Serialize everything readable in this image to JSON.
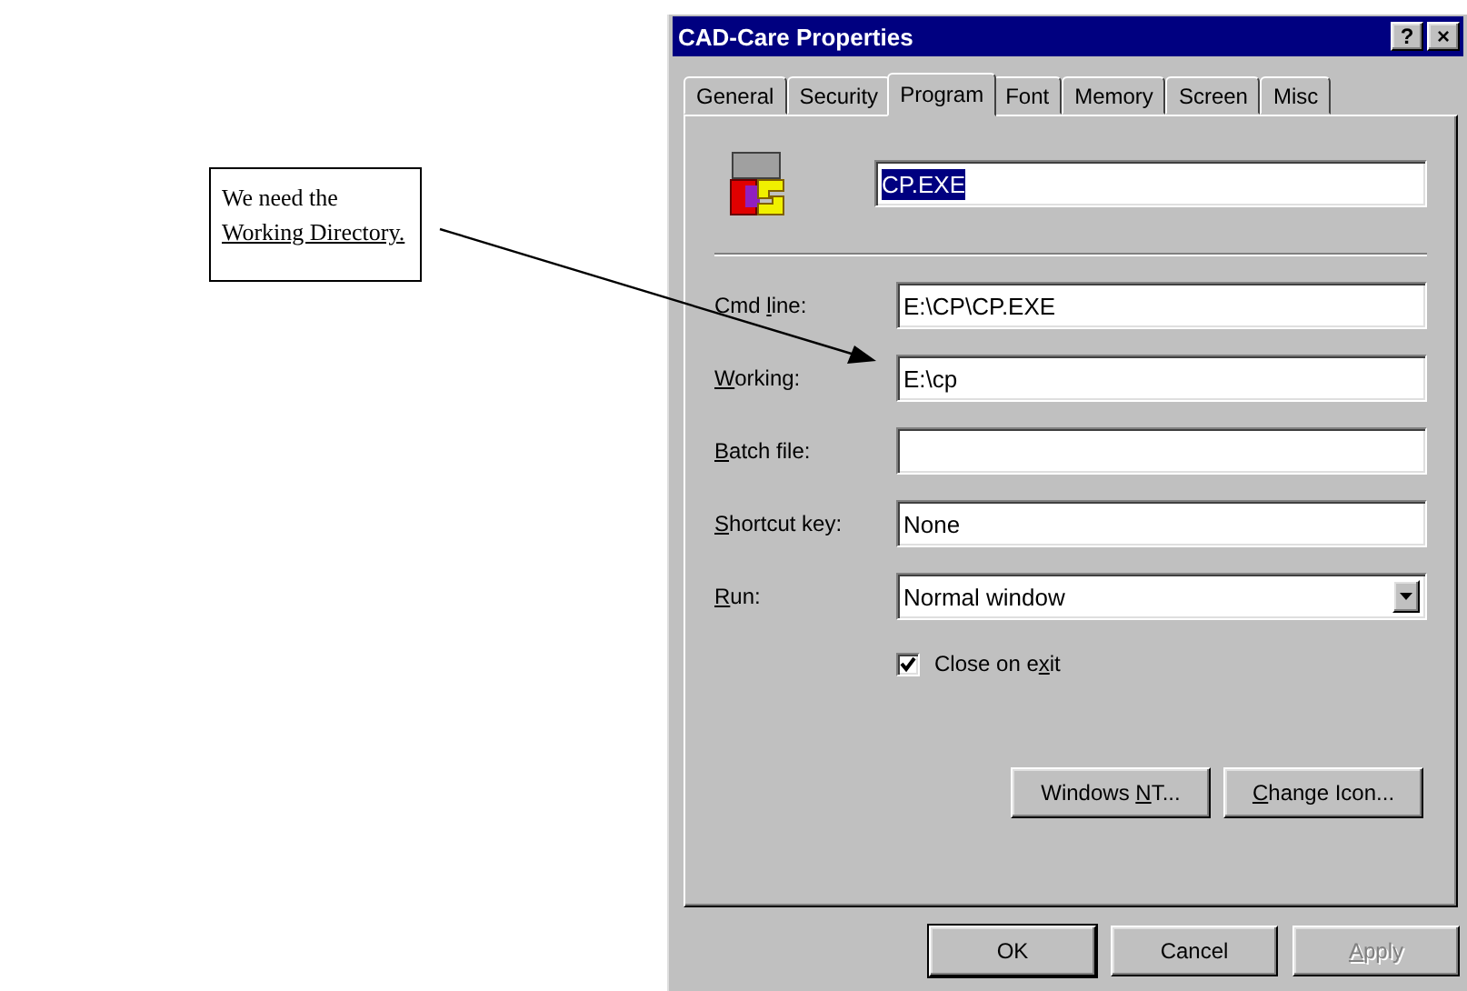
{
  "callout": {
    "lines": [
      {
        "text": "We need the",
        "underlined": false
      },
      {
        "text": "Working Directory.",
        "underlined": true
      }
    ]
  },
  "window": {
    "title": "CAD-Care Properties",
    "help_button": "?",
    "close_button": "×"
  },
  "tabs": [
    {
      "label": "General",
      "selected": false
    },
    {
      "label": "Security",
      "selected": false
    },
    {
      "label": "Program",
      "selected": true
    },
    {
      "label": "Font",
      "selected": false
    },
    {
      "label": "Memory",
      "selected": false
    },
    {
      "label": "Screen",
      "selected": false
    },
    {
      "label": "Misc",
      "selected": false
    }
  ],
  "program_name": {
    "value": "CP.EXE",
    "selected": true
  },
  "fields": [
    {
      "kind": "text",
      "label": {
        "before": "Cmd ",
        "key": "l",
        "after": "ine:"
      },
      "value": "E:\\CP\\CP.EXE"
    },
    {
      "kind": "text",
      "label": {
        "key": "W",
        "after": "orking:"
      },
      "value": "E:\\cp"
    },
    {
      "kind": "text",
      "label": {
        "key": "B",
        "after": "atch file:"
      }
    },
    {
      "kind": "text",
      "label": {
        "key": "S",
        "after": "hortcut key:"
      },
      "value": "None"
    },
    {
      "kind": "dropdown",
      "label": {
        "key": "R",
        "after": "un:"
      },
      "value": "Normal window"
    }
  ],
  "close_on_exit": {
    "label": {
      "before": "Close on e",
      "key": "x",
      "after": "it"
    },
    "checked": true
  },
  "panel_buttons": [
    {
      "label": {
        "before": "Windows ",
        "key": "N",
        "after": "T..."
      }
    },
    {
      "label": {
        "key": "C",
        "after": "hange Icon..."
      }
    }
  ],
  "buttons": [
    {
      "label": {
        "before": "OK"
      },
      "default": true,
      "disabled": false
    },
    {
      "label": {
        "before": "Cancel"
      },
      "default": false,
      "disabled": false
    },
    {
      "label": {
        "key": "A",
        "after": "pply"
      },
      "default": false,
      "disabled": true
    }
  ]
}
